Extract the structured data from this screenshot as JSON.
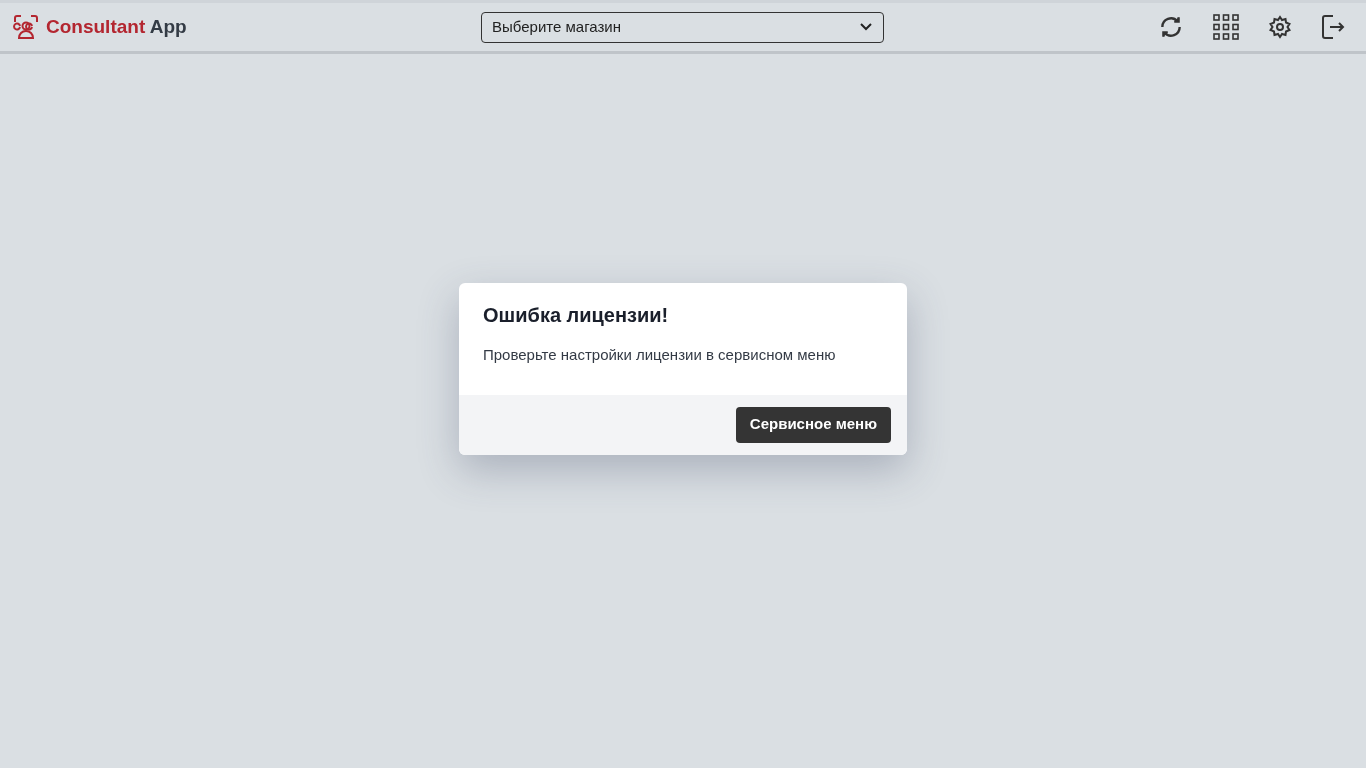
{
  "header": {
    "logo": {
      "brand": "Consultant",
      "suffix": "App"
    },
    "store_select": {
      "placeholder": "Выберите магазин"
    }
  },
  "dialog": {
    "title": "Ошибка лицензии!",
    "message": "Проверьте настройки лицензии в сервисном меню",
    "button": "Сервисное меню"
  }
}
